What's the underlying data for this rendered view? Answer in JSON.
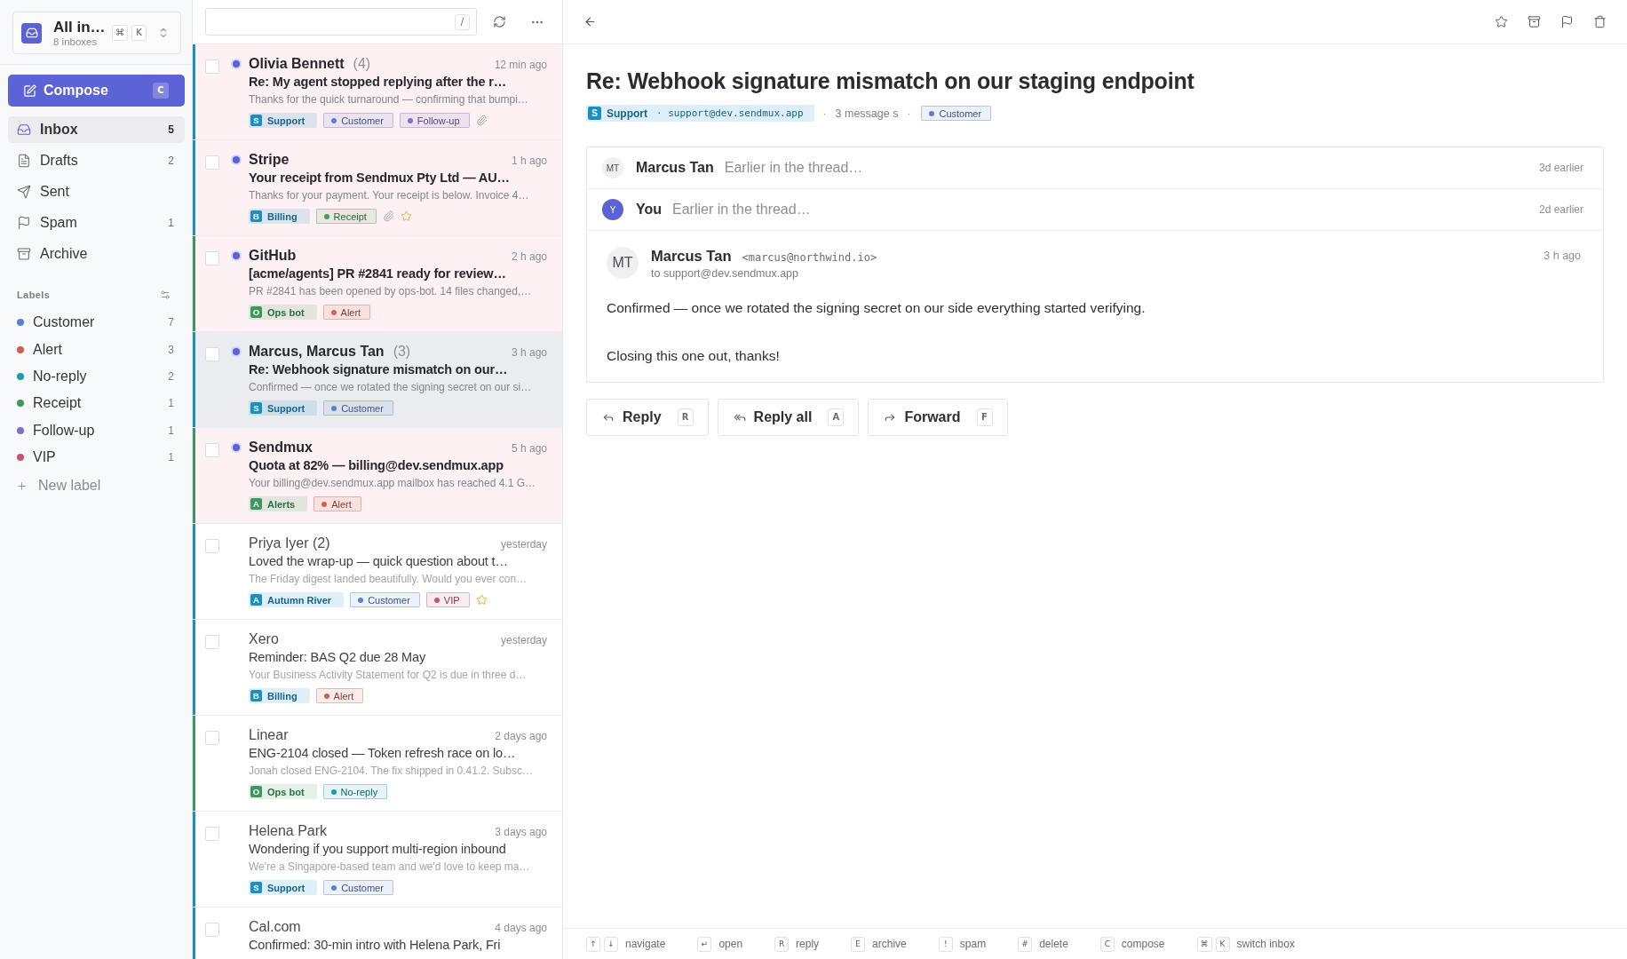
{
  "sidebar": {
    "switcher": {
      "title": "All in…",
      "subtitle": "8 inboxes",
      "keys": [
        "⌘",
        "K"
      ]
    },
    "compose": {
      "label": "Compose",
      "key": "C"
    },
    "nav": [
      {
        "kind": "inbox",
        "label": "Inbox",
        "count": "5",
        "selected": true
      },
      {
        "kind": "drafts",
        "label": "Drafts",
        "count": "2",
        "selected": false
      },
      {
        "kind": "sent",
        "label": "Sent",
        "selected": false
      },
      {
        "kind": "spam",
        "label": "Spam",
        "count": "1",
        "selected": false
      },
      {
        "kind": "archive",
        "label": "Archive",
        "selected": false
      }
    ],
    "labels_heading": "Labels",
    "labels": [
      {
        "name": "Customer",
        "count": "7",
        "color": "#5b7fd6"
      },
      {
        "name": "Alert",
        "count": "3",
        "color": "#cf6150"
      },
      {
        "name": "No-reply",
        "count": "2",
        "color": "#169fa6"
      },
      {
        "name": "Receipt",
        "count": "1",
        "color": "#3f9b5c"
      },
      {
        "name": "Follow-up",
        "count": "1",
        "color": "#7e6fce"
      },
      {
        "name": "VIP",
        "count": "1",
        "color": "#c9536f"
      }
    ],
    "new_label": "New label"
  },
  "list_toolbar": {
    "search": {
      "shortcut": "/"
    }
  },
  "emails": [
    {
      "sender": "Olivia Bennett",
      "count": "(4)",
      "time": "12 min ago",
      "subject": "Re: My agent stopped replying after the r…",
      "preview": "Thanks for the quick turnaround — confirming that bumpi…",
      "inbox": {
        "initial": "S",
        "name": "Support",
        "color": "#1b8ec4"
      },
      "labels": [
        {
          "name": "Customer",
          "color": "#5b7fd6"
        },
        {
          "name": "Follow-up",
          "color": "#7e6fce"
        }
      ],
      "attachment": true,
      "starred": false,
      "unread": true,
      "selected": false,
      "checked": false
    },
    {
      "sender": "Stripe",
      "time": "1 h ago",
      "subject": "Your receipt from Sendmux Pty Ltd — AU…",
      "preview": "Thanks for your payment. Your receipt is below. Invoice 4…",
      "inbox": {
        "initial": "B",
        "name": "Billing",
        "color": "#1b8ec4"
      },
      "labels": [
        {
          "name": "Receipt",
          "color": "#3f9b5c"
        }
      ],
      "attachment": true,
      "starred": true,
      "unread": true,
      "selected": false,
      "checked": false
    },
    {
      "sender": "GitHub",
      "time": "2 h ago",
      "subject": "[acme/agents] PR #2841 ready for review…",
      "preview": "PR #2841 has been opened by ops-bot. 14 files changed,…",
      "inbox": {
        "initial": "O",
        "name": "Ops bot",
        "color": "#3a9a5c"
      },
      "labels": [
        {
          "name": "Alert",
          "color": "#cf6150"
        }
      ],
      "attachment": false,
      "starred": false,
      "unread": true,
      "selected": false,
      "checked": false
    },
    {
      "sender": "Marcus, Marcus Tan",
      "count": "(3)",
      "time": "3 h ago",
      "subject": "Re: Webhook signature mismatch on our…",
      "preview": "Confirmed — once we rotated the signing secret on our si…",
      "inbox": {
        "initial": "S",
        "name": "Support",
        "color": "#1b8ec4"
      },
      "labels": [
        {
          "name": "Customer",
          "color": "#5b7fd6"
        }
      ],
      "attachment": false,
      "starred": false,
      "unread": true,
      "selected": true,
      "checked": false
    },
    {
      "sender": "Sendmux",
      "time": "5 h ago",
      "subject": "Quota at 82% — billing@dev.sendmux.app",
      "preview": "Your billing@dev.sendmux.app mailbox has reached 4.1 G…",
      "inbox": {
        "initial": "A",
        "name": "Alerts",
        "color": "#3a9a5c"
      },
      "labels": [
        {
          "name": "Alert",
          "color": "#cf6150"
        }
      ],
      "attachment": false,
      "starred": false,
      "unread": true,
      "selected": false,
      "checked": false
    },
    {
      "sender": "Priya Iyer (2)",
      "time": "yesterday",
      "subject": "Loved the wrap-up — quick question about t…",
      "preview": "The Friday digest landed beautifully. Would you ever con…",
      "inbox": {
        "initial": "A",
        "name": "Autumn River",
        "color": "#1b8ec4"
      },
      "labels": [
        {
          "name": "Customer",
          "color": "#5b7fd6"
        },
        {
          "name": "VIP",
          "color": "#c9536f"
        }
      ],
      "attachment": false,
      "starred": true,
      "unread": false,
      "selected": false,
      "checked": false
    },
    {
      "sender": "Xero",
      "time": "yesterday",
      "subject": "Reminder: BAS Q2 due 28 May",
      "preview": "Your Business Activity Statement for Q2 is due in three d…",
      "inbox": {
        "initial": "B",
        "name": "Billing",
        "color": "#1b8ec4"
      },
      "labels": [
        {
          "name": "Alert",
          "color": "#cf6150"
        }
      ],
      "attachment": false,
      "starred": false,
      "unread": false,
      "selected": false,
      "checked": false
    },
    {
      "sender": "Linear",
      "time": "2 days ago",
      "subject": "ENG-2104 closed — Token refresh race on lo…",
      "preview": "Jonah closed ENG-2104. The fix shipped in 0.41.2. Subsc…",
      "inbox": {
        "initial": "O",
        "name": "Ops bot",
        "color": "#3a9a5c"
      },
      "labels": [
        {
          "name": "No-reply",
          "color": "#169fa6"
        }
      ],
      "attachment": false,
      "starred": false,
      "unread": false,
      "selected": false,
      "checked": false
    },
    {
      "sender": "Helena Park",
      "time": "3 days ago",
      "subject": "Wondering if you support multi-region inbound",
      "preview": "We're a Singapore-based team and we'd love to keep ma…",
      "inbox": {
        "initial": "S",
        "name": "Support",
        "color": "#1b8ec4"
      },
      "labels": [
        {
          "name": "Customer",
          "color": "#5b7fd6"
        }
      ],
      "attachment": false,
      "starred": false,
      "unread": false,
      "selected": false,
      "checked": false
    },
    {
      "sender": "Cal.com",
      "time": "4 days ago",
      "subject": "Confirmed: 30-min intro with Helena Park, Fri",
      "inbox": {
        "color": "#1b8ec4"
      },
      "unread": false,
      "selected": false,
      "checked": false
    }
  ],
  "reader": {
    "title": "Re: Webhook signature mismatch on our staging endpoint",
    "meta": {
      "inbox": {
        "initial": "S",
        "name": "Support",
        "address": "· support@dev.sendmux.app",
        "color": "#1b8ec4"
      },
      "separator_before": "·",
      "message_count": "3 message s",
      "separator_after": "·",
      "labels": [
        {
          "name": "Customer",
          "color": "#5b7fd6"
        }
      ]
    },
    "messages": [
      {
        "kind": "collapsed",
        "avatar": "MT",
        "color": "#f0f0f2",
        "sender": "Marcus Tan",
        "snippet": "Earlier in the thread…",
        "time": "3d earlier"
      },
      {
        "kind": "collapsed",
        "avatar": "Y",
        "color": "#5a62d6",
        "sender": "You",
        "snippet": "Earlier in the thread…",
        "time": "2d earlier"
      },
      {
        "kind": "expanded",
        "avatar": "MT",
        "color": "#f0f0f2",
        "sender": "Marcus Tan",
        "email": "<marcus@northwind.io>",
        "to": "to support@dev.sendmux.app",
        "time": "3 h ago",
        "body": [
          "Confirmed — once we rotated the signing secret on our side everything started verifying.",
          "Closing this one out, thanks!"
        ]
      }
    ],
    "actions": [
      {
        "kind": "reply",
        "label": "Reply",
        "key": "R"
      },
      {
        "kind": "reply_all",
        "label": "Reply all",
        "key": "A"
      },
      {
        "kind": "forward",
        "label": "Forward",
        "key": "F"
      }
    ]
  },
  "shortcuts": [
    {
      "keys": [
        "↑",
        "↓"
      ],
      "label": "navigate"
    },
    {
      "keys": [
        "↵"
      ],
      "label": "open"
    },
    {
      "keys": [
        "R"
      ],
      "label": "reply"
    },
    {
      "keys": [
        "E"
      ],
      "label": "archive"
    },
    {
      "keys": [
        "!"
      ],
      "label": "spam"
    },
    {
      "keys": [
        "#"
      ],
      "label": "delete"
    },
    {
      "keys": [
        "C"
      ],
      "label": "compose"
    },
    {
      "keys": [
        "⌘",
        "K"
      ],
      "label": "switch inbox"
    }
  ]
}
